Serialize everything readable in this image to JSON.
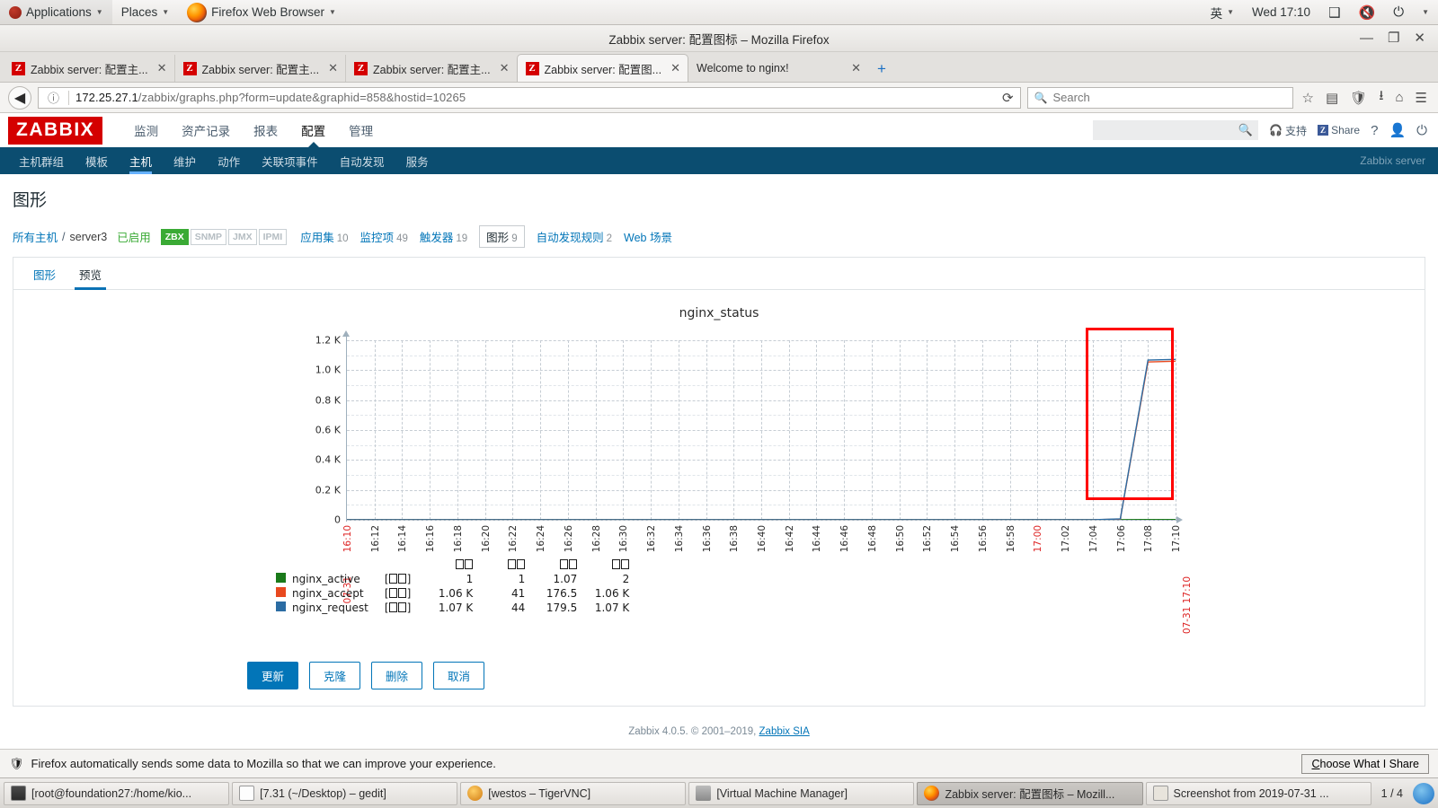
{
  "desktop": {
    "applications_label": "Applications",
    "places_label": "Places",
    "firefox_label": "Firefox Web Browser",
    "input_method": "英",
    "clock": "Wed 17:10"
  },
  "browser": {
    "window_title": "Zabbix server: 配置图标 – Mozilla Firefox",
    "tabs": [
      {
        "label": "Zabbix server: 配置主...",
        "icon": "Z",
        "active": false
      },
      {
        "label": "Zabbix server: 配置主...",
        "icon": "Z",
        "active": false
      },
      {
        "label": "Zabbix server: 配置主...",
        "icon": "Z",
        "active": false
      },
      {
        "label": "Zabbix server: 配置图...",
        "icon": "Z",
        "active": true
      },
      {
        "label": "Welcome to nginx!",
        "icon": "",
        "active": false
      }
    ],
    "new_tab_label": "+",
    "url_host": "172.25.27.1",
    "url_path": "/zabbix/graphs.php?form=update&graphid=858&hostid=10265",
    "search_placeholder": "Search"
  },
  "zabbix": {
    "logo": "ZABBIX",
    "main_nav": [
      {
        "label": "监测",
        "active": false
      },
      {
        "label": "资产记录",
        "active": false
      },
      {
        "label": "报表",
        "active": false
      },
      {
        "label": "配置",
        "active": true
      },
      {
        "label": "管理",
        "active": false
      }
    ],
    "sub_nav": [
      {
        "label": "主机群组",
        "active": false
      },
      {
        "label": "模板",
        "active": false
      },
      {
        "label": "主机",
        "active": true
      },
      {
        "label": "维护",
        "active": false
      },
      {
        "label": "动作",
        "active": false
      },
      {
        "label": "关联项事件",
        "active": false
      },
      {
        "label": "自动发现",
        "active": false
      },
      {
        "label": "服务",
        "active": false
      }
    ],
    "header_links": {
      "support": "支持",
      "share": "Share"
    },
    "search_value": "",
    "server_name": "Zabbix server",
    "page_title": "图形",
    "breadcrumb": {
      "all_hosts": "所有主机",
      "separator": "/",
      "host": "server3",
      "status": "已启用",
      "protocols": [
        {
          "label": "ZBX",
          "enabled": true
        },
        {
          "label": "SNMP",
          "enabled": false
        },
        {
          "label": "JMX",
          "enabled": false
        },
        {
          "label": "IPMI",
          "enabled": false
        }
      ],
      "links": [
        {
          "label": "应用集",
          "count": "10",
          "current": false
        },
        {
          "label": "监控项",
          "count": "49",
          "current": false
        },
        {
          "label": "触发器",
          "count": "19",
          "current": false
        },
        {
          "label": "图形",
          "count": "9",
          "current": true
        },
        {
          "label": "自动发现规则",
          "count": "2",
          "current": false
        },
        {
          "label": "Web 场景",
          "count": "",
          "current": false
        }
      ]
    },
    "form_tabs": [
      {
        "label": "图形",
        "active": false
      },
      {
        "label": "预览",
        "active": true
      }
    ],
    "buttons": [
      {
        "label": "更新",
        "primary": true
      },
      {
        "label": "克隆",
        "primary": false
      },
      {
        "label": "删除",
        "primary": false
      },
      {
        "label": "取消",
        "primary": false
      }
    ],
    "footer": {
      "text": "Zabbix 4.0.5. © 2001–2019, ",
      "link": "Zabbix SIA"
    }
  },
  "chart_data": {
    "type": "line",
    "title": "nginx_status",
    "xlabel": "",
    "ylabel": "",
    "ylim": [
      0,
      1200
    ],
    "grid": true,
    "y_ticks": [
      "0",
      "0.2 K",
      "0.4 K",
      "0.6 K",
      "0.8 K",
      "1.0 K",
      "1.2 K"
    ],
    "y_tick_values": [
      0,
      200,
      400,
      600,
      800,
      1000,
      1200
    ],
    "x_range_start": "07-31 16:10",
    "x_range_end": "07-31 17:10",
    "x_ticks": [
      "16:10",
      "16:12",
      "16:14",
      "16:16",
      "16:18",
      "16:20",
      "16:22",
      "16:24",
      "16:26",
      "16:28",
      "16:30",
      "16:32",
      "16:34",
      "16:36",
      "16:38",
      "16:40",
      "16:42",
      "16:44",
      "16:46",
      "16:48",
      "16:50",
      "16:52",
      "16:54",
      "16:56",
      "16:58",
      "17:00",
      "17:02",
      "17:04",
      "17:06",
      "17:08",
      "17:10"
    ],
    "x_ticks_highlighted": [
      "16:10",
      "17:00"
    ],
    "legend_headers": [
      "最小",
      "平均",
      "最大",
      "最后"
    ],
    "legend_headers_rendered": "tofu",
    "series": [
      {
        "name": "nginx_active",
        "color": "#1a7a1a",
        "aggregation": "[所有]",
        "min": "1",
        "avg": "1",
        "max": "1.07",
        "last": "2",
        "values": [
          1,
          1,
          1,
          1,
          1,
          1,
          1,
          1,
          1,
          1,
          1,
          1,
          1,
          1,
          1,
          1,
          1,
          1,
          1,
          1,
          1,
          1,
          1,
          1,
          1,
          1,
          1,
          1,
          1,
          2,
          2
        ]
      },
      {
        "name": "nginx_accept",
        "color": "#e8491f",
        "aggregation": "[所有]",
        "min": "1.06 K",
        "avg": "41",
        "max": "176.5",
        "last": "1.06 K",
        "values": [
          0,
          0,
          0,
          0,
          0,
          0,
          0,
          0,
          0,
          0,
          0,
          0,
          0,
          0,
          0,
          0,
          0,
          0,
          0,
          0,
          0,
          0,
          0,
          0,
          0,
          0,
          0,
          0,
          5,
          1055,
          1060
        ]
      },
      {
        "name": "nginx_request",
        "color": "#2b6ca3",
        "aggregation": "[所有]",
        "min": "1.07 K",
        "avg": "44",
        "max": "179.5",
        "last": "1.07 K",
        "values": [
          0,
          0,
          0,
          0,
          0,
          0,
          0,
          0,
          0,
          0,
          0,
          0,
          0,
          0,
          0,
          0,
          0,
          0,
          0,
          0,
          0,
          0,
          0,
          0,
          0,
          0,
          0,
          0,
          6,
          1068,
          1072
        ]
      }
    ],
    "annotation": {
      "type": "rectangle",
      "color": "#ff0000",
      "x_start": "17:08",
      "x_end": "17:10"
    }
  },
  "notification": {
    "message": "Firefox automatically sends some data to Mozilla so that we can improve your experience.",
    "button_label": "Choose What I Share"
  },
  "taskbar": {
    "items": [
      {
        "label": "[root@foundation27:/home/kio...",
        "active": false
      },
      {
        "label": "[7.31 (~/Desktop) – gedit]",
        "active": false
      },
      {
        "label": "[westos – TigerVNC]",
        "active": false
      },
      {
        "label": "[Virtual Machine Manager]",
        "active": false
      },
      {
        "label": "Zabbix server: 配置图标 – Mozill...",
        "active": true
      },
      {
        "label": "Screenshot from 2019-07-31 ...",
        "active": false
      }
    ],
    "workspace": "1 / 4"
  }
}
